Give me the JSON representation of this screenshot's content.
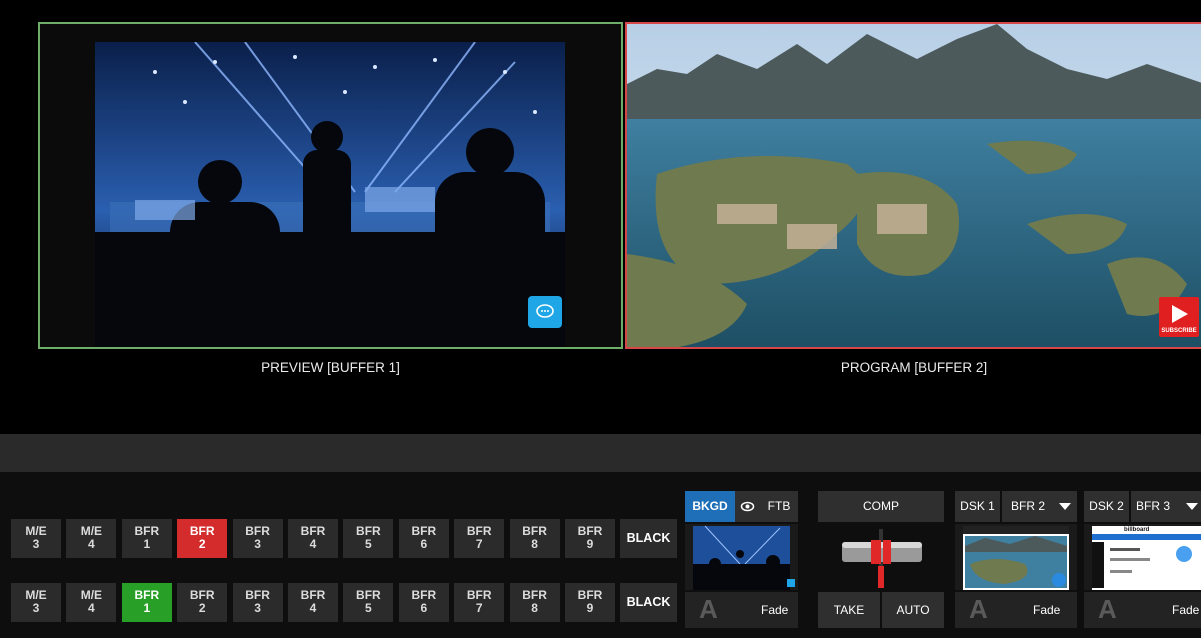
{
  "monitors": {
    "preview_label": "PREVIEW [BUFFER 1]",
    "program_label": "PROGRAM [BUFFER 2]",
    "subscribe": "SUBSCRIBE"
  },
  "colors": {
    "preview_border": "#6fae6a",
    "program_border": "#d64848",
    "program_row_active": "#d42c2c",
    "preview_row_active": "#28a028",
    "accent_blue": "#1f6fb8"
  },
  "program_row": [
    {
      "top": "M/E",
      "num": "3"
    },
    {
      "top": "M/E",
      "num": "4"
    },
    {
      "top": "BFR",
      "num": "1"
    },
    {
      "top": "BFR",
      "num": "2",
      "active": true
    },
    {
      "top": "BFR",
      "num": "3"
    },
    {
      "top": "BFR",
      "num": "4"
    },
    {
      "top": "BFR",
      "num": "5"
    },
    {
      "top": "BFR",
      "num": "6"
    },
    {
      "top": "BFR",
      "num": "7"
    },
    {
      "top": "BFR",
      "num": "8"
    },
    {
      "top": "BFR",
      "num": "9"
    }
  ],
  "preview_row": [
    {
      "top": "M/E",
      "num": "3"
    },
    {
      "top": "M/E",
      "num": "4"
    },
    {
      "top": "BFR",
      "num": "1",
      "active": true
    },
    {
      "top": "BFR",
      "num": "2"
    },
    {
      "top": "BFR",
      "num": "3"
    },
    {
      "top": "BFR",
      "num": "4"
    },
    {
      "top": "BFR",
      "num": "5"
    },
    {
      "top": "BFR",
      "num": "6"
    },
    {
      "top": "BFR",
      "num": "7"
    },
    {
      "top": "BFR",
      "num": "8"
    },
    {
      "top": "BFR",
      "num": "9"
    }
  ],
  "black_label": "BLACK",
  "transition": {
    "bkgd": "BKGD",
    "ftb": "FTB",
    "comp": "COMP",
    "take": "TAKE",
    "auto": "AUTO",
    "fade": "Fade"
  },
  "dsk1": {
    "label": "DSK 1",
    "source": "BFR 2",
    "fade": "Fade"
  },
  "dsk2": {
    "label": "DSK 2",
    "source": "BFR 3",
    "fade": "Fade",
    "thumb_title": "billboard"
  },
  "a_glyph": "A"
}
